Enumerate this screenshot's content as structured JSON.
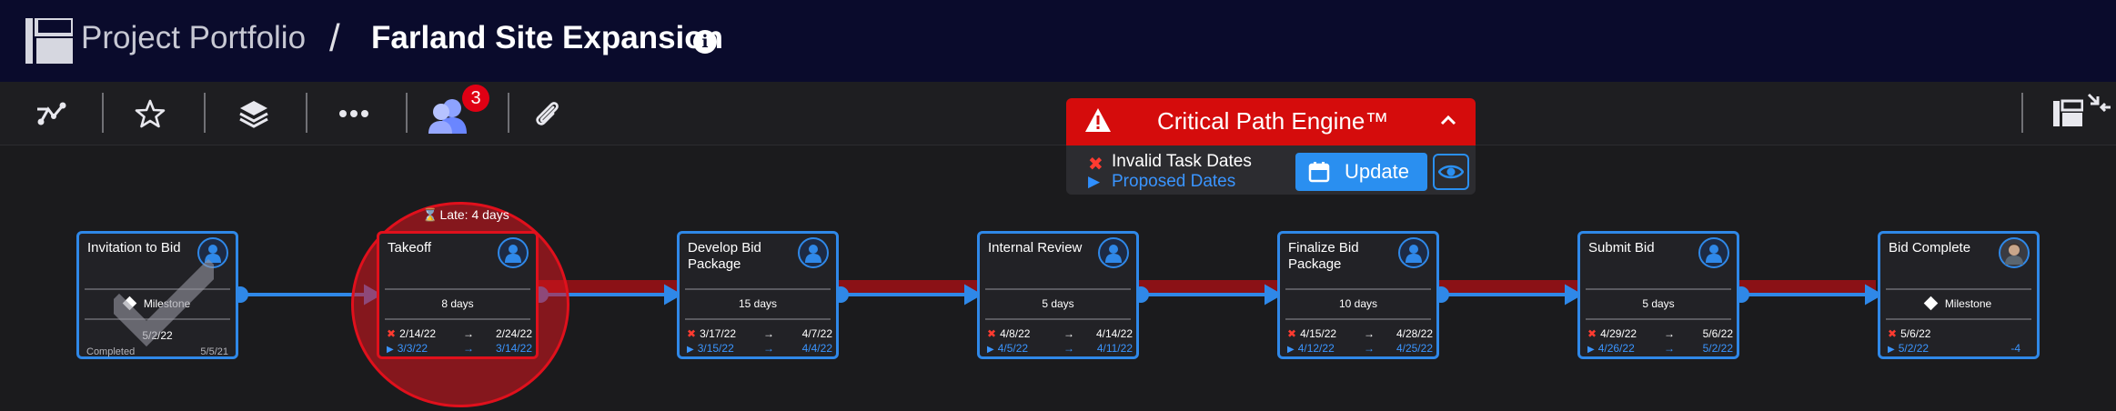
{
  "header": {
    "breadcrumb_root": "Project Portfolio",
    "separator": "/",
    "project_title": "Farland Site Expansion"
  },
  "toolbar": {
    "icons": [
      "critical-path-icon",
      "star-icon",
      "layers-icon",
      "more-icon",
      "team-icon",
      "paperclip-icon",
      "panel-icon",
      "collapse-icon"
    ],
    "notification_count": "3"
  },
  "critical_path_engine": {
    "title": "Critical Path Engine™",
    "invalid_label": "Invalid Task Dates",
    "proposed_label": "Proposed Dates",
    "update_label": "Update"
  },
  "late_label": "Late: 4 days",
  "colors": {
    "accent": "#2f88e8",
    "critical": "#d50c0c",
    "header_bg": "#0a0b2c"
  },
  "tasks": [
    {
      "name": "Invitation to Bid",
      "type": "Milestone",
      "date": "5/2/22",
      "status": "Completed",
      "status_date": "5/5/21"
    },
    {
      "name": "Takeoff",
      "duration": "8 days",
      "start": "2/14/22",
      "end": "2/24/22",
      "proposed_start": "3/3/22",
      "proposed_end": "3/14/22"
    },
    {
      "name": "Develop Bid Package",
      "duration": "15 days",
      "start": "3/17/22",
      "end": "4/7/22",
      "proposed_start": "3/15/22",
      "proposed_end": "4/4/22"
    },
    {
      "name": "Internal Review",
      "duration": "5 days",
      "start": "4/8/22",
      "end": "4/14/22",
      "proposed_start": "4/5/22",
      "proposed_end": "4/11/22"
    },
    {
      "name": "Finalize Bid Package",
      "duration": "10 days",
      "start": "4/15/22",
      "end": "4/28/22",
      "proposed_start": "4/12/22",
      "proposed_end": "4/25/22"
    },
    {
      "name": "Submit Bid",
      "duration": "5 days",
      "start": "4/29/22",
      "end": "5/6/22",
      "proposed_start": "4/26/22",
      "proposed_end": "5/2/22"
    },
    {
      "name": "Bid Complete",
      "type": "Milestone",
      "start": "5/6/22",
      "proposed_start": "5/2/22",
      "delta": "-4"
    }
  ]
}
